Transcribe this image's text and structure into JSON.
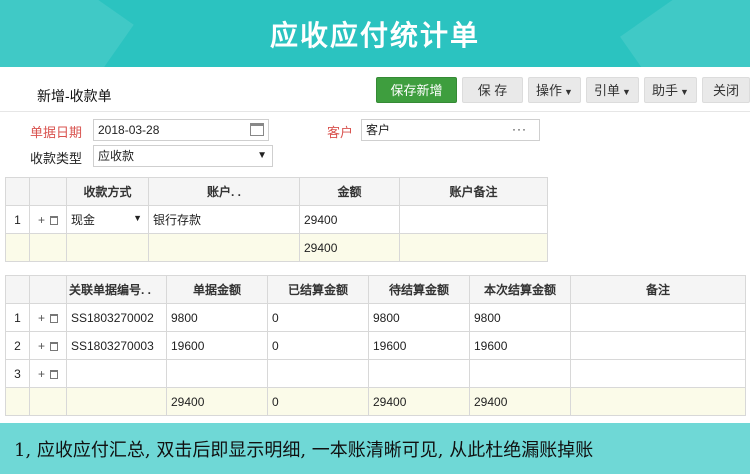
{
  "banner": {
    "title": "应收应付统计单"
  },
  "toolbar": {
    "doc_title": "新增-收款单",
    "save_new": "保存新增",
    "save": "保 存",
    "operate": "操作",
    "import": "引单",
    "assistant": "助手",
    "close": "关闭"
  },
  "form": {
    "date_label": "单据日期",
    "date_value": "2018-03-28",
    "customer_label": "客户",
    "customer_value": "客户",
    "type_label": "收款类型",
    "type_value": "应收款"
  },
  "payment_table": {
    "headers": [
      "收款方式",
      "账户. .",
      "金额",
      "账户备注"
    ],
    "rows": [
      {
        "index": "1",
        "method": "现金",
        "account": "银行存款",
        "amount": "29400",
        "note": ""
      }
    ],
    "total": "29400"
  },
  "link_table": {
    "headers": [
      "关联单据编号. .",
      "单据金额",
      "已结算金额",
      "待结算金额",
      "本次结算金额",
      "备注"
    ],
    "rows": [
      {
        "index": "1",
        "doc_no": "SS1803270002",
        "doc_amount": "9800",
        "settled": "0",
        "pending": "9800",
        "this_settle": "9800",
        "note": ""
      },
      {
        "index": "2",
        "doc_no": "SS1803270003",
        "doc_amount": "19600",
        "settled": "0",
        "pending": "19600",
        "this_settle": "19600",
        "note": ""
      },
      {
        "index": "3",
        "doc_no": "",
        "doc_amount": "",
        "settled": "",
        "pending": "",
        "this_settle": "",
        "note": ""
      }
    ],
    "total": {
      "doc_amount": "29400",
      "settled": "0",
      "pending": "29400",
      "this_settle": "29400"
    }
  },
  "footer": {
    "text": "1, 应收应付汇总, 双击后即显示明细, 一本账清晰可见, 从此杜绝漏账掉账"
  },
  "colors": {
    "banner": "#2bc3c0",
    "footer": "#6fd8d6",
    "primary_button": "#3e9e3e",
    "required_label": "#d9534f",
    "total_row": "#fbfbe9"
  }
}
